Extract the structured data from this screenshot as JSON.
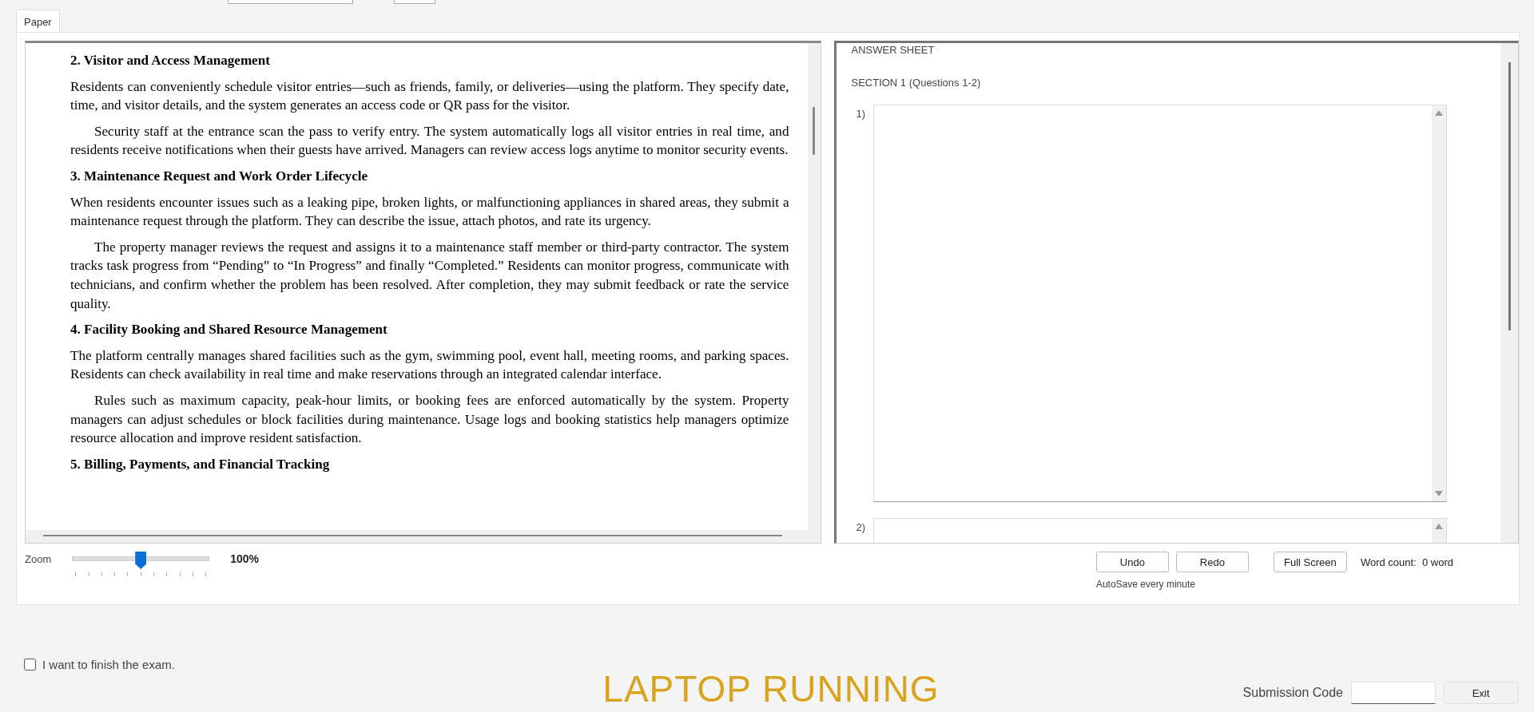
{
  "tabs": [
    {
      "label": "Paper",
      "selected": true
    }
  ],
  "paper": {
    "blocks": [
      {
        "kind": "heading",
        "text": "2. Visitor and Access Management"
      },
      {
        "kind": "paragraph",
        "indent": false,
        "text": "Residents can conveniently schedule visitor entries—such as friends, family, or deliveries—using the platform. They specify date, time, and visitor details, and the system generates an access code or QR pass for the visitor."
      },
      {
        "kind": "paragraph",
        "indent": true,
        "text": "Security staff at the entrance scan the pass to verify entry. The system automatically logs all visitor entries in real time, and residents receive notifications when their guests have arrived. Managers can review access logs anytime to monitor security events."
      },
      {
        "kind": "heading",
        "text": "3. Maintenance Request and Work Order Lifecycle"
      },
      {
        "kind": "paragraph",
        "indent": false,
        "text": "When residents encounter issues such as a leaking pipe, broken lights, or malfunctioning appliances in shared areas, they submit a maintenance request through the platform. They can describe the issue, attach photos, and rate its urgency."
      },
      {
        "kind": "paragraph",
        "indent": true,
        "text": "The property manager reviews the request and assigns it to a maintenance staff member or third-party contractor. The system tracks task progress from “Pending” to “In Progress” and finally “Completed.” Residents can monitor progress, communicate with technicians, and confirm whether the problem has been resolved. After completion, they may submit feedback or rate the service quality."
      },
      {
        "kind": "heading",
        "text": "4. Facility Booking and Shared Resource Management"
      },
      {
        "kind": "paragraph",
        "indent": false,
        "text": "The platform centrally manages shared facilities such as the gym, swimming pool, event hall, meeting rooms, and parking spaces. Residents can check availability in real time and make reservations through an integrated calendar interface."
      },
      {
        "kind": "paragraph",
        "indent": true,
        "text": "Rules such as maximum capacity, peak-hour limits, or booking fees are enforced automatically by the system. Property managers can adjust schedules or block facilities during maintenance. Usage logs and booking statistics help managers optimize resource allocation and improve resident satisfaction."
      },
      {
        "kind": "heading",
        "text": "5. Billing, Payments, and Financial Tracking"
      }
    ]
  },
  "answer_sheet": {
    "title": "ANSWER SHEET",
    "section": "SECTION 1 (Questions 1-2)",
    "questions": [
      {
        "number": "1)"
      },
      {
        "number": "2)"
      }
    ]
  },
  "zoom": {
    "label": "Zoom",
    "level": 0.5,
    "reading": "100%"
  },
  "editor_buttons": [
    "Undo",
    "Redo",
    "Full Screen"
  ],
  "word_count": "Word count:  0 word",
  "autosave": "AutoSave every minute",
  "finish_checkbox": {
    "label": "I want to finish the exam.",
    "checked": false
  },
  "banner": "LAPTOP RUNNING",
  "submission": {
    "label": "Submission Code",
    "button": "Exit"
  }
}
